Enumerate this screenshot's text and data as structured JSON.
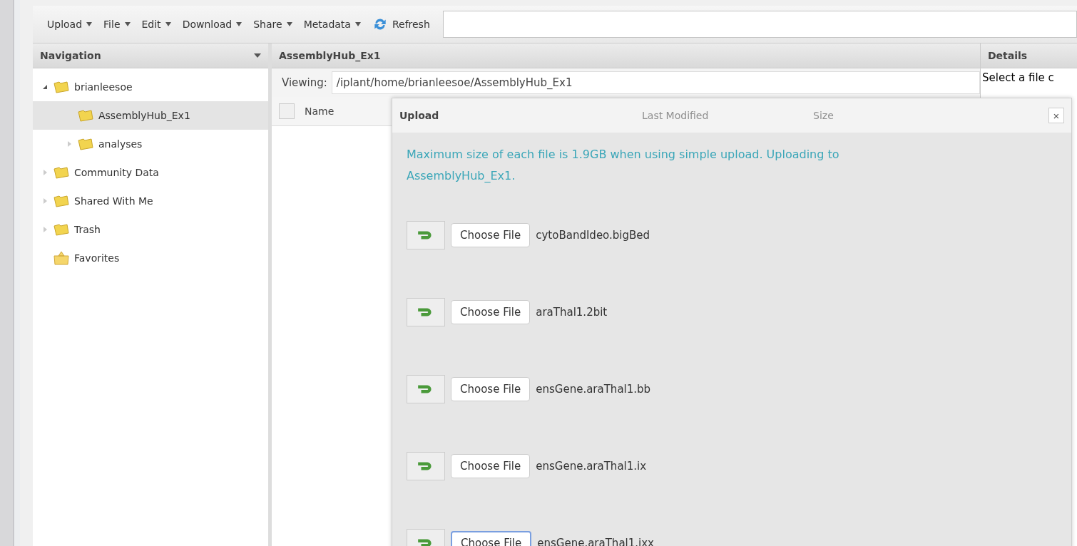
{
  "toolbar": {
    "menus": [
      {
        "label": "Upload"
      },
      {
        "label": "File"
      },
      {
        "label": "Edit"
      },
      {
        "label": "Download"
      },
      {
        "label": "Share"
      },
      {
        "label": "Metadata"
      }
    ],
    "refresh": "Refresh"
  },
  "navigation": {
    "title": "Navigation",
    "tree": [
      {
        "label": "brianleesoe",
        "kind": "folder",
        "expanded": true,
        "selected": false,
        "children": [
          {
            "label": "AssemblyHub_Ex1",
            "kind": "folder",
            "selected": true
          },
          {
            "label": "analyses",
            "kind": "folder",
            "expanded": false,
            "selected": false
          }
        ]
      },
      {
        "label": "Community Data",
        "kind": "folder",
        "expanded": false,
        "selected": false
      },
      {
        "label": "Shared With Me",
        "kind": "folder",
        "expanded": false,
        "selected": false
      },
      {
        "label": "Trash",
        "kind": "folder",
        "expanded": false,
        "selected": false
      },
      {
        "label": "Favorites",
        "kind": "favorites",
        "selected": false
      }
    ]
  },
  "main": {
    "title": "AssemblyHub_Ex1",
    "viewing_label": "Viewing:",
    "select_all_checked": false,
    "path": "/iplant/home/brianleesoe/AssemblyHub_Ex1",
    "columns": [
      "Name",
      "Last Modified",
      "Size"
    ]
  },
  "details": {
    "title": "Details",
    "text": "Select a file c"
  },
  "upload_dialog": {
    "title": "Upload",
    "close": "×",
    "message": "Maximum size of each file is 1.9GB when using simple upload. Uploading to AssemblyHub_Ex1.",
    "rows": [
      {
        "button": "Choose File",
        "file": "cytoBandIdeo.bigBed",
        "focused": false
      },
      {
        "button": "Choose File",
        "file": "araThal1.2bit",
        "focused": false
      },
      {
        "button": "Choose File",
        "file": "ensGene.araThal1.bb",
        "focused": false
      },
      {
        "button": "Choose File",
        "file": "ensGene.araThal1.ix",
        "focused": false
      },
      {
        "button": "Choose File",
        "file": "ensGene.araThal1.ixx",
        "focused": true
      }
    ]
  }
}
